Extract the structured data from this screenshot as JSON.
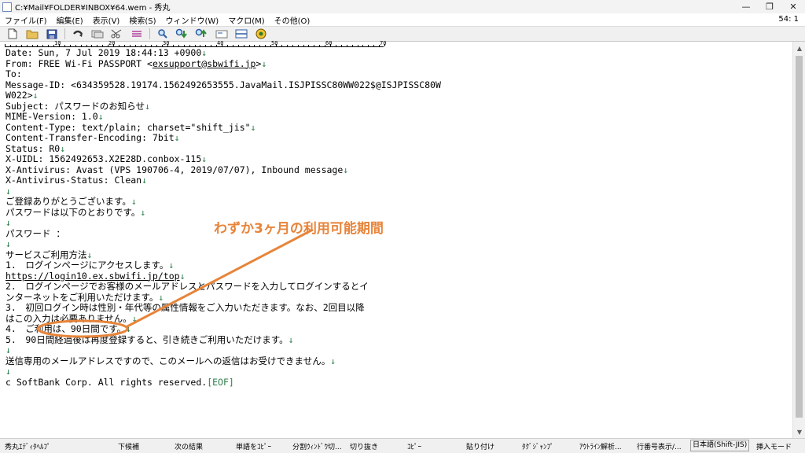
{
  "window": {
    "title": "C:¥Mail¥FOLDER¥INBOX¥64.wem - 秀丸",
    "buttons": [
      "—",
      "❐",
      "✕"
    ]
  },
  "menubar": {
    "items": [
      "ファイル(F)",
      "編集(E)",
      "表示(V)",
      "検索(S)",
      "ウィンドウ(W)",
      "マクロ(M)",
      "その他(O)"
    ],
    "cursor_position": "54: 1"
  },
  "toolbar": {
    "icons": [
      "new-file-icon",
      "open-folder-icon",
      "save-icon",
      "undo-icon",
      "redo-icon",
      "cut-icon",
      "copy-icon",
      "paste-icon",
      "search-icon",
      "search-down-icon",
      "search-up-icon",
      "grep-icon",
      "window-split-icon",
      "hidemaru-icon"
    ]
  },
  "ruler": {
    "marks": [
      "10",
      "20",
      "30",
      "40",
      "50",
      "60",
      "70"
    ]
  },
  "email": {
    "lines": [
      {
        "text": "Date: Sun, 7 Jul 2019 18:44:13 +0900",
        "nl": true
      },
      {
        "text": "From: FREE Wi-Fi PASSPORT <",
        "link": "exsupport@sbwifi.jp",
        "after": ">",
        "nl": true
      },
      {
        "text": "To: ",
        "nl": false
      },
      {
        "text": "Message-ID: <634359528.19174.1562492653555.JavaMail.ISJPISSC80WW022$@ISJPISSC80W",
        "nl": false
      },
      {
        "text": "W022>",
        "nl": true
      },
      {
        "text": "Subject: パスワードのお知らせ",
        "nl": true
      },
      {
        "text": "MIME-Version: 1.0",
        "nl": true
      },
      {
        "text": "Content-Type: text/plain; charset=\"shift_jis\"",
        "nl": true
      },
      {
        "text": "Content-Transfer-Encoding: 7bit",
        "nl": true
      },
      {
        "text": "Status: R0",
        "nl": true
      },
      {
        "text": "X-UIDL: 1562492653.X2E28D.conbox-115",
        "nl": true
      },
      {
        "text": "X-Antivirus: Avast (VPS 190706-4, 2019/07/07), Inbound message",
        "nl": true
      },
      {
        "text": "X-Antivirus-Status: Clean",
        "nl": true
      },
      {
        "text": "",
        "nl": true
      },
      {
        "text": "ご登録ありがとうございます。",
        "nl": true
      },
      {
        "text": "パスワードは以下のとおりです。",
        "nl": true
      },
      {
        "text": "",
        "nl": true
      },
      {
        "text": "パスワード ：",
        "nl": false
      },
      {
        "text": "",
        "nl": true
      },
      {
        "text": "サービスご利用方法",
        "nl": true
      },
      {
        "text": "1.　ログインページにアクセスします。",
        "nl": true
      },
      {
        "text": "",
        "link": "https://login10.ex.sbwifi.jp/top",
        "after": "",
        "nl": true
      },
      {
        "text": "2.　ログインページでお客様のメールアドレスとパスワードを入力してログインするとイ",
        "nl": false
      },
      {
        "text": "ンターネットをご利用いただけます。",
        "nl": true
      },
      {
        "text": "3.　初回ログイン時は性別・年代等の属性情報をご入力いただきます。なお、2回目以降",
        "nl": false
      },
      {
        "text": "はこの入力は必要ありません。",
        "nl": true
      },
      {
        "text": "4.　ご利用は、90日間です。",
        "nl": true
      },
      {
        "text": "5.　90日間経過後は再度登録すると、引き続きご利用いただけます。",
        "nl": true
      },
      {
        "text": "",
        "nl": true
      },
      {
        "text": "送信専用のメールアドレスですので、このメールへの返信はお受けできません。",
        "nl": true
      },
      {
        "text": "",
        "nl": true
      },
      {
        "text": "c SoftBank Corp. All rights reserved.",
        "eof": "[EOF]",
        "nl": false
      }
    ],
    "newline_mark": "↓"
  },
  "annotation": {
    "text": "わずか3ヶ月の利用可能期間",
    "color": "#e7843a"
  },
  "statusbar": {
    "fkeys": [
      "秀丸ｴﾃﾞｨﾀﾍﾙﾌﾟ",
      "下候補",
      "次の結果",
      "単語をｺﾋﾟｰ",
      "分割ｳｨﾝﾄﾞｳ切...",
      "切り抜き",
      "ｺﾋﾟｰ",
      "貼り付け",
      "ﾀｸﾞｼﾞｬﾝﾌﾟ",
      "ｱｳﾄﾗｲﾝ解析...",
      "行番号表示/...",
      "日本語(Shift-JIS)",
      "挿入モード"
    ]
  }
}
